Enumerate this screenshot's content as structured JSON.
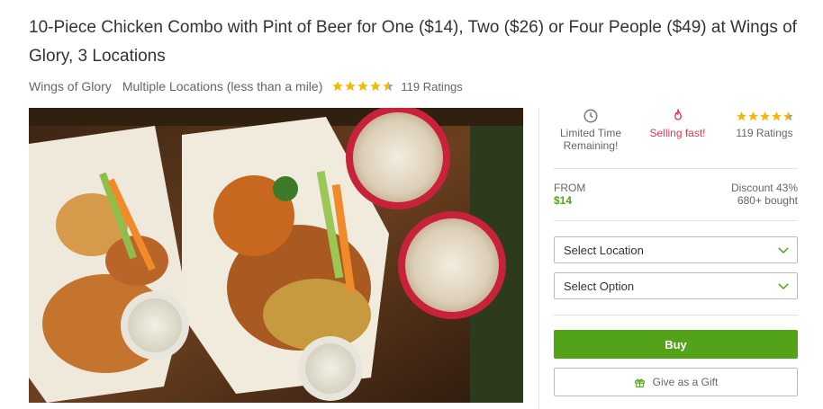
{
  "deal": {
    "title": "10-Piece Chicken Combo with Pint of Beer for One ($14), Two ($26) or Four People ($49) at Wings of Glory, 3 Locations",
    "merchant": "Wings of Glory",
    "locations": "Multiple Locations (less than a mile)",
    "rating_stars": 4.5,
    "ratings_text": "119 Ratings"
  },
  "image": {
    "icon": "food-photo"
  },
  "panel": {
    "limited_time_line1": "Limited Time",
    "limited_time_line2": "Remaining!",
    "selling_fast": "Selling fast!",
    "ratings_text": "119 Ratings",
    "from_label": "FROM",
    "price": "$14",
    "discount": "Discount 43%",
    "bought": "680+ bought",
    "select_location": "Select Location",
    "select_option": "Select Option",
    "buy_label": "Buy",
    "gift_label": "Give as a Gift"
  },
  "colors": {
    "accent_green": "#53a318",
    "selling_red": "#e8344e",
    "star_gold": "#f5b800"
  }
}
